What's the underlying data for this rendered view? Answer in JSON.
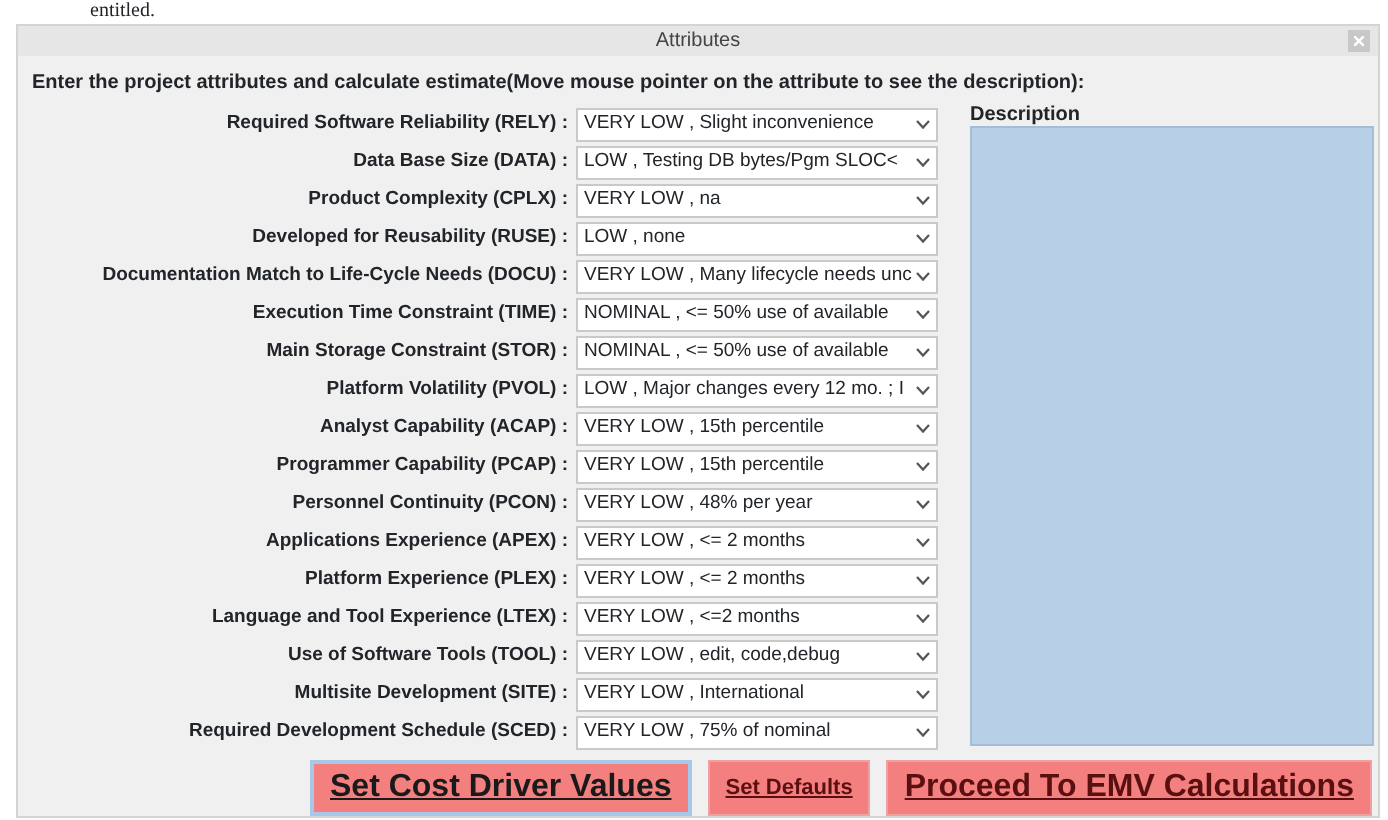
{
  "document_text": "entitled.",
  "window": {
    "title": "Attributes"
  },
  "instruction": "Enter the project attributes and calculate estimate(Move mouse pointer on the attribute to see the description):",
  "attributes": [
    {
      "label": "Required Software Reliability (RELY) :",
      "value": "VERY LOW , Slight inconvenience"
    },
    {
      "label": "Data Base Size (DATA) :",
      "value": "LOW , Testing DB bytes/Pgm SLOC<"
    },
    {
      "label": "Product Complexity (CPLX) :",
      "value": "VERY LOW , na"
    },
    {
      "label": "Developed for Reusability (RUSE) :",
      "value": "LOW , none"
    },
    {
      "label": "Documentation Match to Life-Cycle Needs (DOCU) :",
      "value": "VERY LOW , Many lifecycle needs unc"
    },
    {
      "label": "Execution Time Constraint (TIME) :",
      "value": "NOMINAL , <= 50% use of available"
    },
    {
      "label": "Main Storage Constraint (STOR) :",
      "value": "NOMINAL , <= 50% use of available"
    },
    {
      "label": "Platform Volatility (PVOL) :",
      "value": "LOW , Major changes every 12 mo. ; I"
    },
    {
      "label": "Analyst Capability (ACAP) :",
      "value": "VERY LOW , 15th percentile"
    },
    {
      "label": "Programmer Capability (PCAP) :",
      "value": "VERY LOW , 15th percentile"
    },
    {
      "label": "Personnel Continuity (PCON) :",
      "value": "VERY LOW , 48% per year"
    },
    {
      "label": "Applications Experience (APEX) :",
      "value": "VERY LOW , <= 2 months"
    },
    {
      "label": "Platform Experience (PLEX) :",
      "value": "VERY LOW , <= 2 months"
    },
    {
      "label": "Language and Tool Experience (LTEX) :",
      "value": "VERY LOW , <=2 months"
    },
    {
      "label": "Use of Software Tools (TOOL) :",
      "value": "VERY LOW , edit, code,debug"
    },
    {
      "label": "Multisite Development (SITE) :",
      "value": "VERY LOW , International"
    },
    {
      "label": "Required Development Schedule (SCED) :",
      "value": "VERY LOW , 75% of nominal"
    }
  ],
  "description": {
    "label": "Description"
  },
  "buttons": [
    {
      "label": "Set Cost Driver Values",
      "kind": "large",
      "selected": true
    },
    {
      "label": "Set Defaults",
      "kind": "small",
      "selected": false
    },
    {
      "label": "Proceed To EMV Calculations",
      "kind": "large",
      "selected": false
    }
  ]
}
